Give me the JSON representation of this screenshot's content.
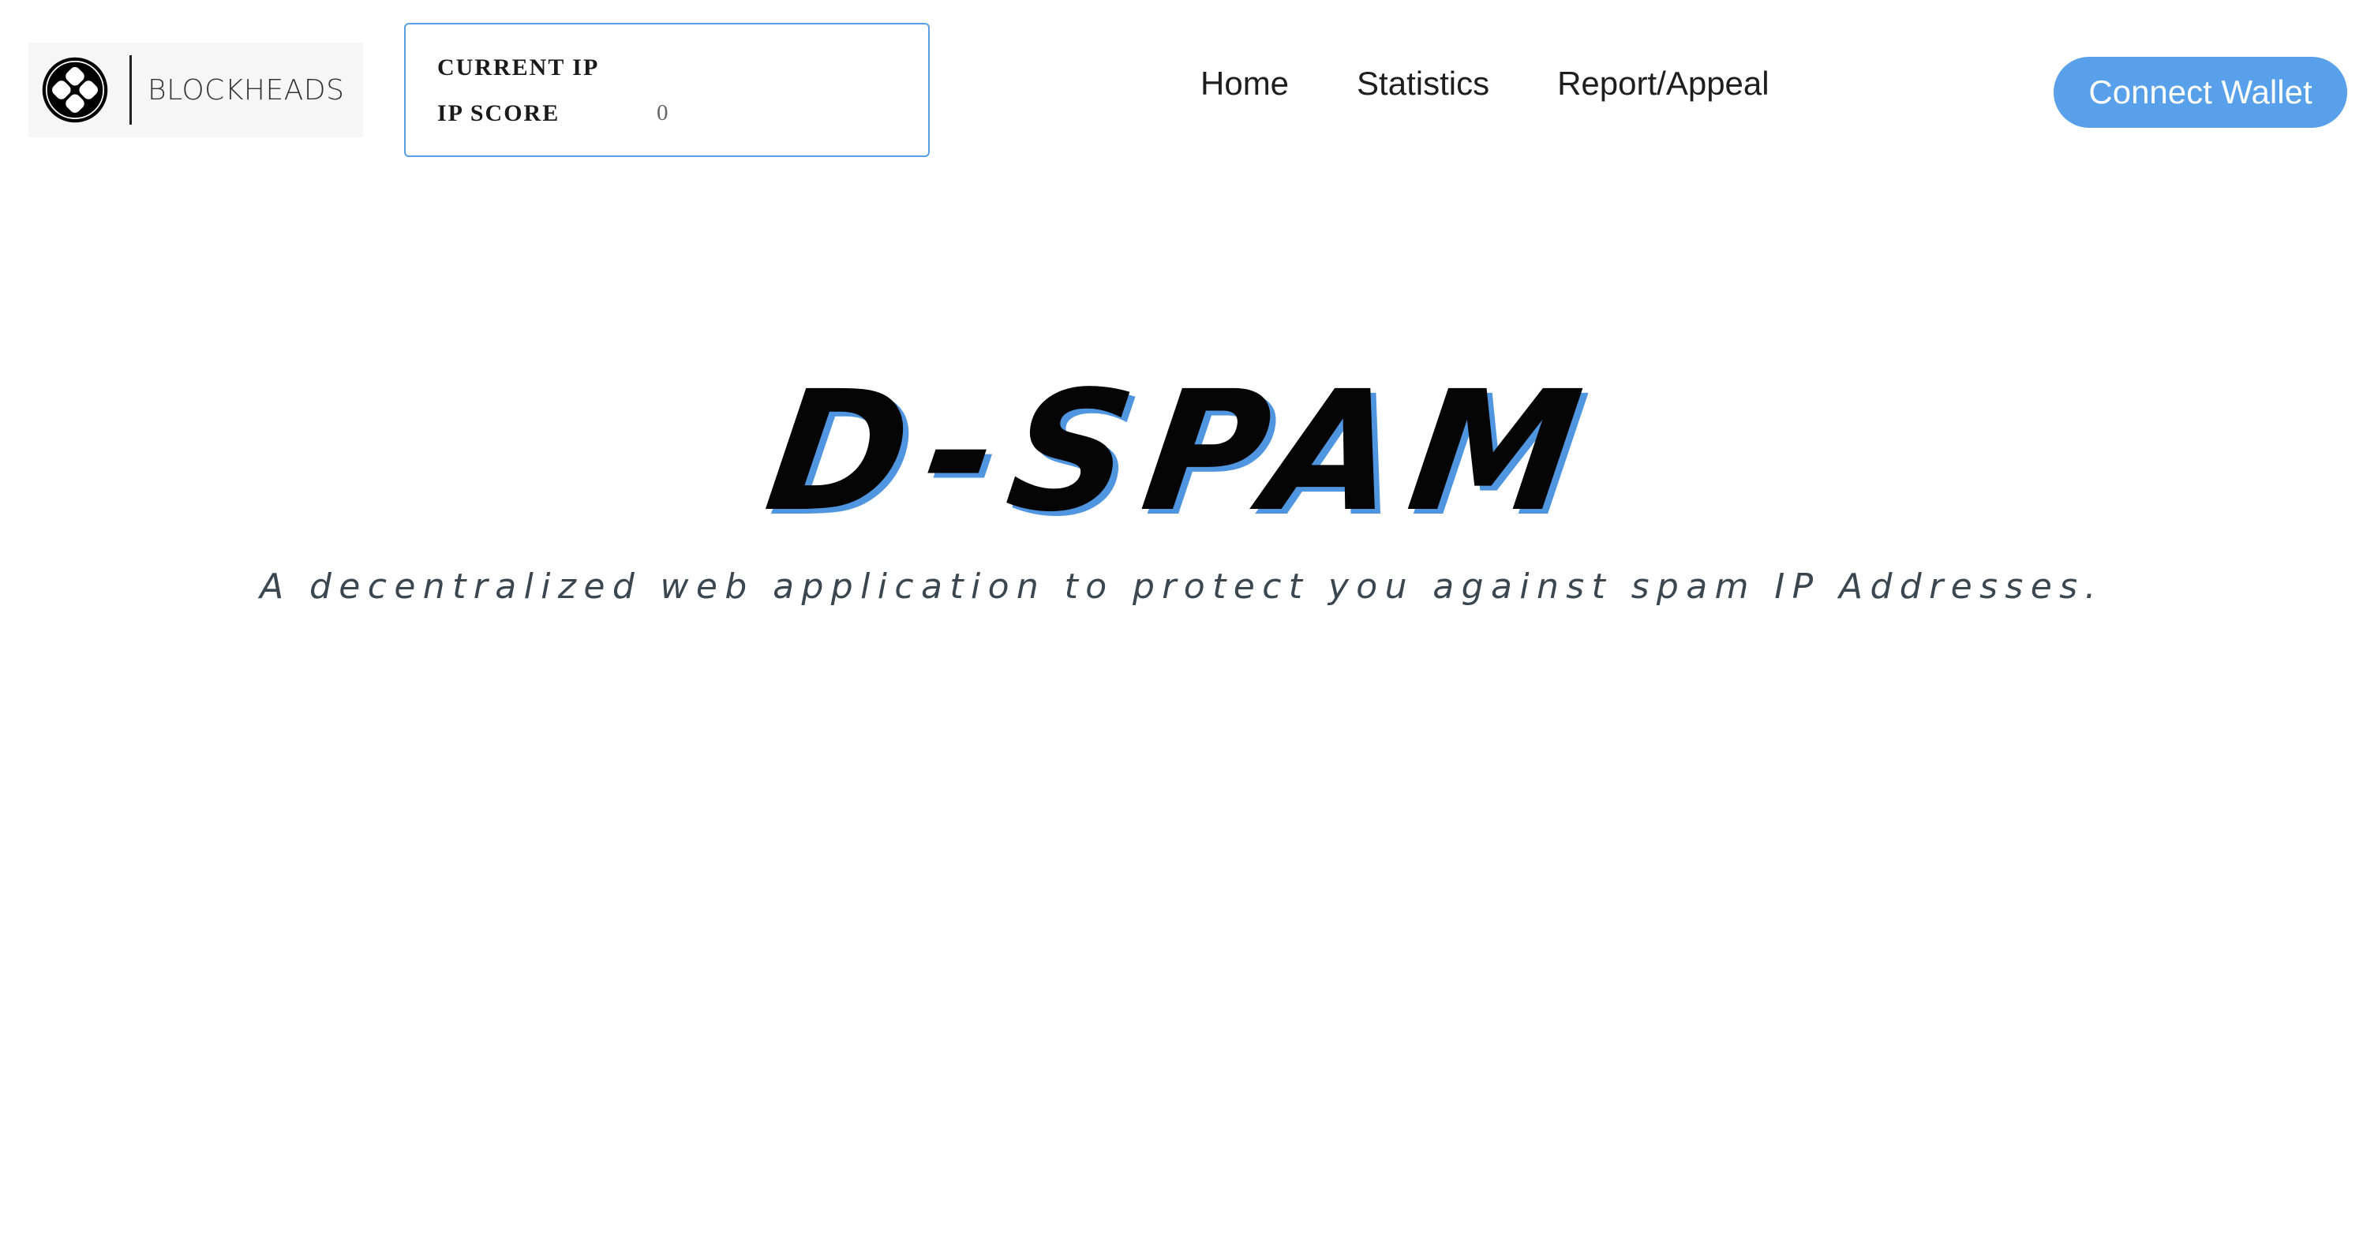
{
  "header": {
    "logo_text": "BLOCKHEADS",
    "ip_panel": {
      "current_ip_label": "CURRENT IP",
      "ip_score_label": "IP SCORE",
      "ip_score_value": "0"
    },
    "nav": [
      {
        "label": "Home"
      },
      {
        "label": "Statistics"
      },
      {
        "label": "Report/Appeal"
      }
    ],
    "connect_wallet_label": "Connect Wallet",
    "accent_color": "#58a0ea"
  },
  "hero": {
    "title": "D-SPAM",
    "subtitle": "A decentralized web application to protect you against spam IP Addresses."
  }
}
